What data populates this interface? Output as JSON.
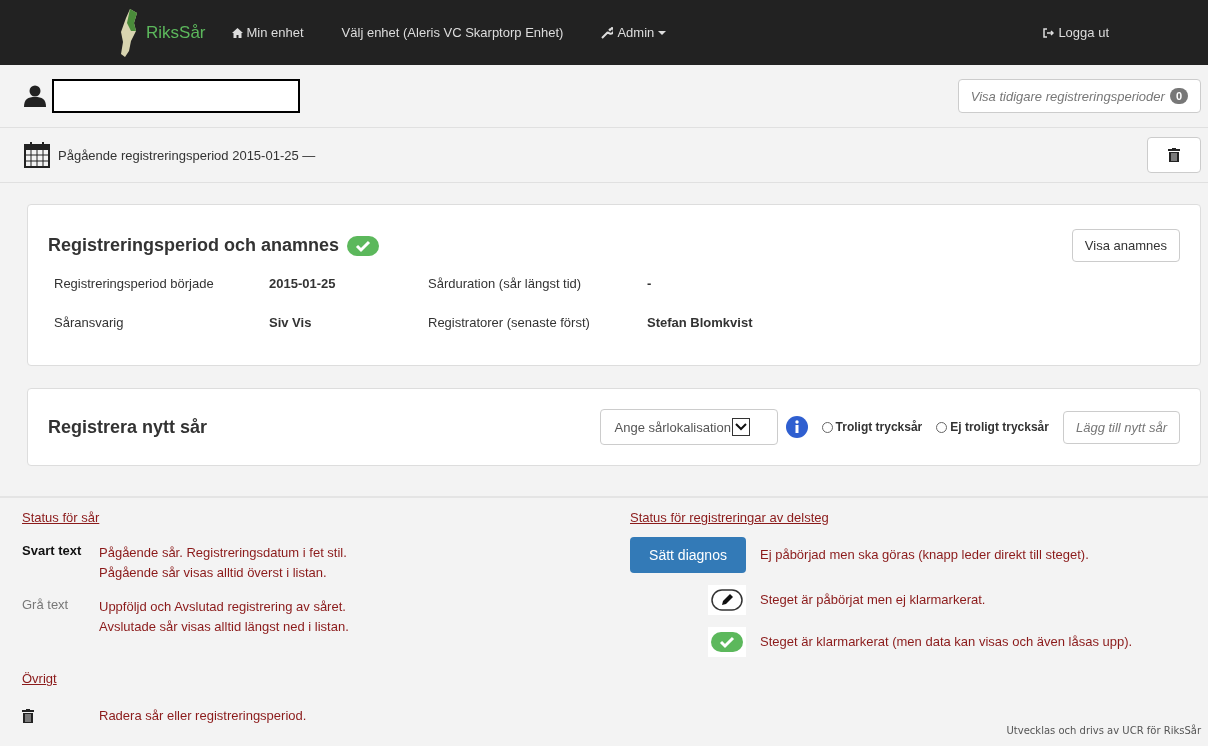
{
  "navbar": {
    "brand": "RiksSår",
    "items": [
      {
        "kind": "home",
        "label": "Min enhet"
      },
      {
        "kind": "plain",
        "label": "Välj enhet (Aleris VC Skarptorp Enhet)"
      },
      {
        "kind": "admin",
        "label": "Admin"
      }
    ],
    "logout": "Logga ut"
  },
  "patient": {
    "previous_button": "Visa tidigare registreringsperioder",
    "previous_count": "0"
  },
  "period": {
    "title": "Pågående registreringsperiod 2015-01-25 —"
  },
  "anamnes": {
    "title": "Registreringsperiod och anamnes",
    "done": true,
    "button": "Visa anamnes",
    "fields": [
      {
        "label": "Registreringsperiod började",
        "value": "2015-01-25"
      },
      {
        "label": "Sårduration (sår längst tid)",
        "value": "-"
      },
      {
        "label": "Såransvarig",
        "value": "Siv Vis"
      },
      {
        "label": "Registratorer (senaste först)",
        "value": "Stefan Blomkvist"
      }
    ]
  },
  "new_wound": {
    "title": "Registrera nytt sår",
    "select": "Ange sårlokalisation",
    "radios": [
      {
        "label": "Troligt trycksår",
        "selected": false
      },
      {
        "label": "Ej troligt trycksår",
        "selected": false
      }
    ],
    "add_button": "Lägg till nytt sår"
  },
  "legend": {
    "wound_status_title": "Status för sår",
    "wound_status": [
      {
        "kind": "black",
        "term": "Svart text",
        "lines": [
          "Pågående sår. Registreringsdatum i fet stil.",
          "Pågående sår visas alltid överst i listan."
        ]
      },
      {
        "kind": "gray",
        "term": "Grå text",
        "lines": [
          "Uppföljd och Avslutad registrering av såret.",
          "Avslutade sår visas alltid längst ned i listan."
        ]
      }
    ],
    "other_title": "Övrigt",
    "other": [
      {
        "kind": "trash",
        "text": "Radera sår eller registreringsperiod."
      }
    ],
    "steps_title": "Status för registreringar av delsteg",
    "steps": [
      {
        "kind": "button",
        "button": "Sätt diagnos",
        "text": "Ej påbörjad men ska göras (knapp leder direkt till steget)."
      },
      {
        "kind": "edit",
        "text": "Steget är påbörjat men ej klarmarkerat."
      },
      {
        "kind": "done",
        "text": "Steget är klarmarkerat (men data kan visas och även låsas upp)."
      }
    ]
  },
  "footer": "Utvecklas och drivs av UCR för RiksSår"
}
